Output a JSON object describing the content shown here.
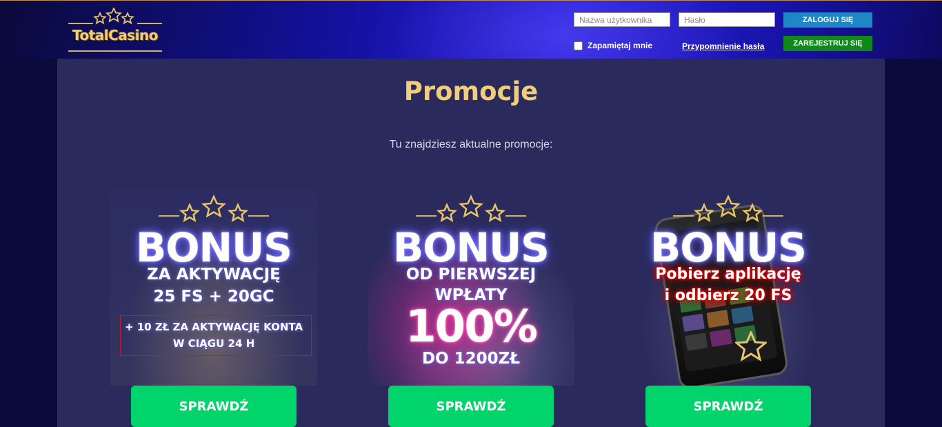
{
  "header": {
    "logo_text": "TotalCasino",
    "username_placeholder": "Nazwa użytkownika",
    "password_placeholder": "Hasło",
    "login_label": "ZALOGUJ SIĘ",
    "register_label": "ZAREJESTRUJ SIĘ",
    "remember_label": "Zapamiętaj mnie",
    "forgot_label": "Przypomnienie hasła"
  },
  "main": {
    "title": "Promocje",
    "subtitle": "Tu znajdziesz aktualne promocje:",
    "cards": [
      {
        "heading": "BONUS",
        "line1": "ZA AKTYWACJĘ",
        "line2": "25 FS + 20GC",
        "line3": "+ 10 ZŁ ZA AKTYWACJĘ KONTA",
        "line4": "W CIĄGU 24 H",
        "cta": "SPRAWDŹ"
      },
      {
        "heading": "BONUS",
        "line1": "OD PIERWSZEJ",
        "line2": "WPŁATY",
        "line3": "100%",
        "line4": "DO 1200ZŁ",
        "cta": "SPRAWDŹ"
      },
      {
        "heading": "BONUS",
        "line1": "Pobierz aplikację",
        "line2": "i odbierz 20 FS",
        "cta": "SPRAWDŹ"
      }
    ]
  },
  "colors": {
    "accent_gold": "#f2cd7c",
    "login_blue": "#1f86c8",
    "register_green": "#0f8a1a",
    "cta_green": "#00d46a",
    "panel": "#2a2b5c"
  },
  "icons": [
    "star-icon",
    "clock-icon",
    "phone-illustration"
  ]
}
